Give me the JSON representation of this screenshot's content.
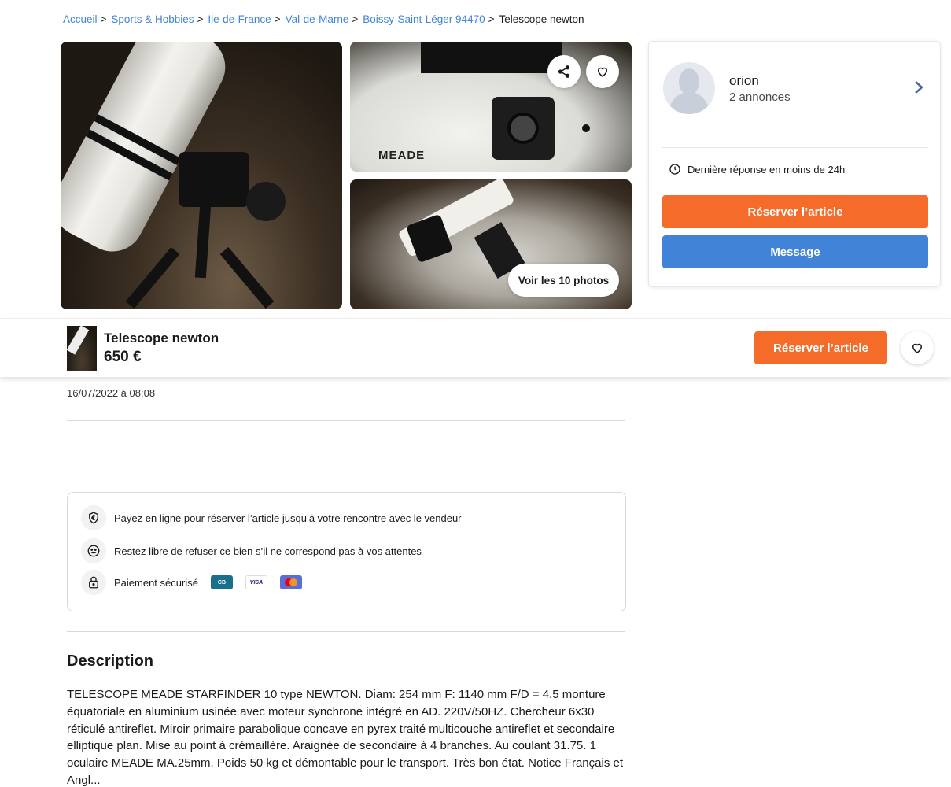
{
  "breadcrumb": {
    "items": [
      "Accueil",
      "Sports & Hobbies",
      "Ile-de-France",
      "Val-de-Marne",
      "Boissy-Saint-Léger 94470"
    ],
    "separator": ">",
    "current": "Telescope newton"
  },
  "gallery": {
    "see_photos_label": "Voir les 10 photos",
    "photo_brand_text": "MEADE",
    "share_icon": "share-icon",
    "favorite_icon": "heart-icon"
  },
  "seller": {
    "name": "orion",
    "listings": "2 annonces",
    "response_time": "Dernière réponse en moins de 24h",
    "reserve_label": "Réserver l’article",
    "message_label": "Message"
  },
  "sticky": {
    "title": "Telescope newton",
    "price": "650 €",
    "reserve_label": "Réserver l’article"
  },
  "listing": {
    "date": "16/07/2022 à 08:08"
  },
  "payment": {
    "line1": "Payez en ligne pour réserver l’article jusqu’à votre rencontre avec le vendeur",
    "line2": "Restez libre de refuser ce bien s’il ne correspond pas à vos attentes",
    "line3": "Paiement sécurisé",
    "card_cb": "CB",
    "card_visa": "VISA"
  },
  "description": {
    "title": "Description",
    "text": "TELESCOPE MEADE STARFINDER 10 type NEWTON. Diam: 254 mm F: 1140 mm F/D = 4.5 monture équatoriale en aluminium usinée avec moteur synchrone intégré en AD. 220V/50HZ. Chercheur 6x30 réticulé antireflet. Miroir primaire parabolique concave en pyrex traité multicouche antireflet et secondaire elliptique plan. Mise au point à crémaillère. Araignée de secondaire à 4 branches. Au coulant 31.75. 1 oculaire MEADE MA.25mm. Poids 50 kg et démontable pour le transport. Très bon état. Notice Français et Angl..."
  },
  "colors": {
    "accent_orange": "#f56b2a",
    "accent_blue": "#4183d7",
    "link": "#4183d7"
  }
}
